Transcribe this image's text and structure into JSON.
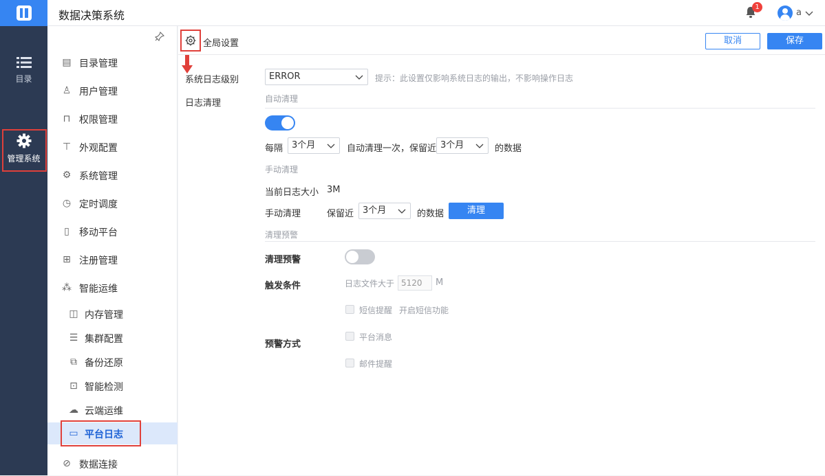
{
  "app": {
    "title": "数据决策系统",
    "notification_count": "1",
    "user": "a"
  },
  "rail": {
    "items": [
      {
        "label": "目录",
        "icon": "list-icon"
      },
      {
        "label": "管理系统",
        "icon": "gear-icon"
      }
    ]
  },
  "menu": {
    "items": [
      {
        "label": "目录管理",
        "icon": "catalog-icon"
      },
      {
        "label": "用户管理",
        "icon": "user-icon"
      },
      {
        "label": "权限管理",
        "icon": "lock-icon"
      },
      {
        "label": "外观配置",
        "icon": "paint-roller-icon"
      },
      {
        "label": "系统管理",
        "icon": "settings-icon"
      },
      {
        "label": "定时调度",
        "icon": "timer-icon"
      },
      {
        "label": "移动平台",
        "icon": "mobile-icon"
      },
      {
        "label": "注册管理",
        "icon": "register-icon"
      },
      {
        "label": "智能运维",
        "icon": "ops-icon"
      }
    ],
    "sub_items": [
      {
        "label": "内存管理",
        "icon": "memory-icon"
      },
      {
        "label": "集群配置",
        "icon": "cluster-icon"
      },
      {
        "label": "备份还原",
        "icon": "backup-icon"
      },
      {
        "label": "智能检测",
        "icon": "monitor-icon"
      },
      {
        "label": "云端运维",
        "icon": "cloud-icon"
      },
      {
        "label": "平台日志",
        "icon": "log-icon"
      }
    ],
    "last_item": {
      "label": "数据连接",
      "icon": "link-icon"
    }
  },
  "toolbar": {
    "title": "全局设置",
    "cancel": "取消",
    "save": "保存"
  },
  "settings": {
    "log_level_label": "系统日志级别",
    "log_level_value": "ERROR",
    "log_level_hint": "提示：此设置仅影响系统日志的输出，不影响操作日志",
    "log_clean_label": "日志清理",
    "auto_clean_section": "自动清理",
    "auto_clean_enabled": true,
    "every_label": "每隔",
    "interval_value": "3个月",
    "auto_clean_text": "自动清理一次，保留近",
    "retain_value": "3个月",
    "data_suffix": "的数据",
    "manual_clean_section": "手动清理",
    "current_size_label": "当前日志大小",
    "current_size_value": "3M",
    "manual_clean_label": "手动清理",
    "keep_recent_label": "保留近",
    "manual_retain_value": "3个月",
    "manual_data_suffix": "的数据",
    "clean_button": "清理",
    "warning_section": "清理预警",
    "warning_label": "清理预警",
    "warning_enabled": false,
    "trigger_label": "触发条件",
    "file_size_label": "日志文件大于",
    "file_size_value": "5120",
    "file_size_unit": "M",
    "sms_label": "短信提醒",
    "sms_hint": "开启短信功能",
    "method_label": "预警方式",
    "platform_msg_label": "平台消息",
    "email_label": "邮件提醒"
  }
}
